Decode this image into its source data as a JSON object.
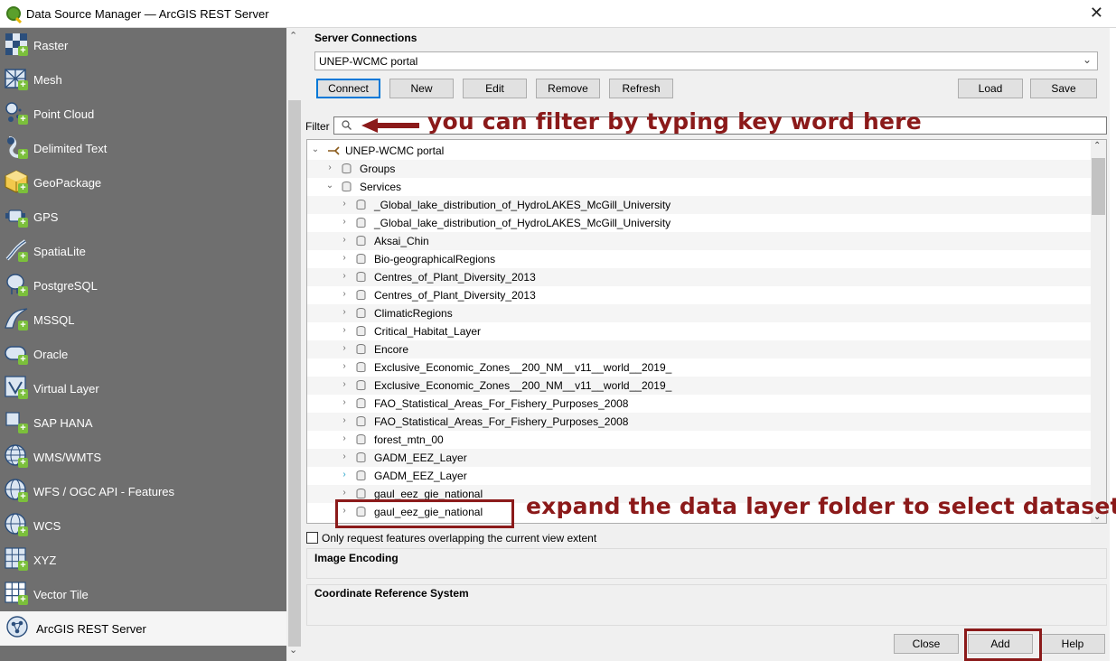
{
  "window": {
    "title": "Data Source Manager — ArcGIS REST Server",
    "close_glyph": "✕"
  },
  "sidebar": {
    "items": [
      {
        "label": "Raster",
        "icon": "raster-icon"
      },
      {
        "label": "Mesh",
        "icon": "mesh-icon"
      },
      {
        "label": "Point Cloud",
        "icon": "point-cloud-icon"
      },
      {
        "label": "Delimited Text",
        "icon": "delimited-text-icon"
      },
      {
        "label": "GeoPackage",
        "icon": "geopackage-icon"
      },
      {
        "label": "GPS",
        "icon": "gps-icon"
      },
      {
        "label": "SpatiaLite",
        "icon": "spatialite-icon"
      },
      {
        "label": "PostgreSQL",
        "icon": "postgresql-icon"
      },
      {
        "label": "MSSQL",
        "icon": "mssql-icon"
      },
      {
        "label": "Oracle",
        "icon": "oracle-icon"
      },
      {
        "label": "Virtual Layer",
        "icon": "virtual-layer-icon"
      },
      {
        "label": "SAP HANA",
        "icon": "sap-hana-icon"
      },
      {
        "label": "WMS/WMTS",
        "icon": "wms-icon"
      },
      {
        "label": "WFS / OGC API - Features",
        "icon": "wfs-icon"
      },
      {
        "label": "WCS",
        "icon": "wcs-icon"
      },
      {
        "label": "XYZ",
        "icon": "xyz-icon"
      },
      {
        "label": "Vector Tile",
        "icon": "vector-tile-icon"
      },
      {
        "label": "ArcGIS REST Server",
        "icon": "arcgis-rest-icon",
        "active": true
      }
    ]
  },
  "server_connections": {
    "title": "Server Connections",
    "selected": "UNEP-WCMC portal",
    "buttons": {
      "connect": "Connect",
      "new": "New",
      "edit": "Edit",
      "remove": "Remove",
      "refresh": "Refresh",
      "load": "Load",
      "save": "Save"
    }
  },
  "filter": {
    "label": "Filter",
    "value": ""
  },
  "tree": {
    "root": "UNEP-WCMC portal",
    "groups_label": "Groups",
    "services_label": "Services",
    "services": [
      "_Global_lake_distribution_of_HydroLAKES_McGill_University",
      "_Global_lake_distribution_of_HydroLAKES_McGill_University",
      "Aksai_Chin",
      "Bio-geographicalRegions",
      "Centres_of_Plant_Diversity_2013",
      "Centres_of_Plant_Diversity_2013",
      "ClimaticRegions",
      "Critical_Habitat_Layer",
      "Encore",
      "Exclusive_Economic_Zones__200_NM__v11__world__2019_",
      "Exclusive_Economic_Zones__200_NM__v11__world__2019_",
      "FAO_Statistical_Areas_For_Fishery_Purposes_2008",
      "FAO_Statistical_Areas_For_Fishery_Purposes_2008",
      "forest_mtn_00",
      "GADM_EEZ_Layer",
      "GADM_EEZ_Layer",
      "gaul_eez_gie_national",
      "gaul_eez_gie_national"
    ]
  },
  "options": {
    "overlap_label": "Only request features overlapping the current view extent",
    "image_encoding_title": "Image Encoding",
    "crs_title": "Coordinate Reference System"
  },
  "footer": {
    "close": "Close",
    "add": "Add",
    "help": "Help"
  },
  "annotations": {
    "filter_hint": "you can filter by typing key word here",
    "expand_hint": "expand the data layer folder to select dataset",
    "color": "#8b1a1a"
  }
}
